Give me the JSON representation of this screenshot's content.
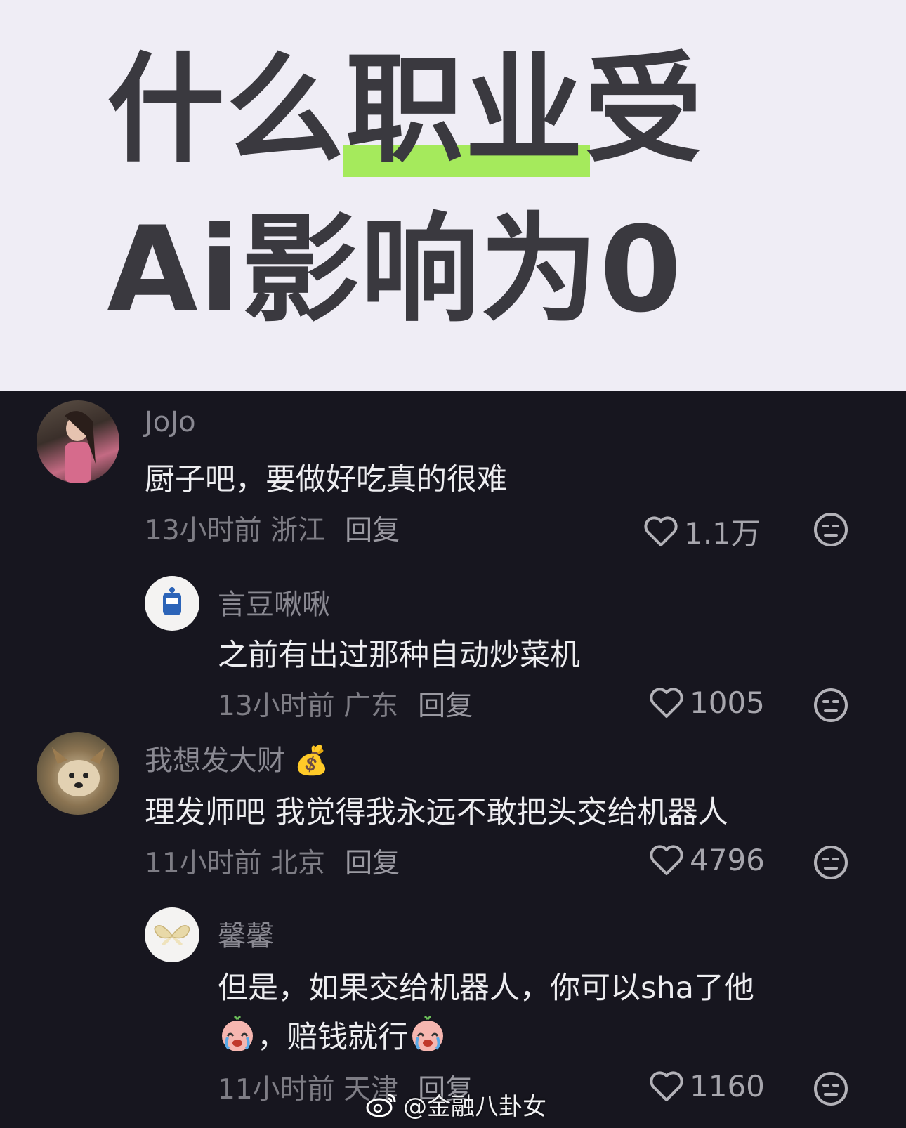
{
  "banner": {
    "title_line1_pre": "什么",
    "title_line1_highlight": "职业",
    "title_line1_post": "受",
    "title_line2": "Ai影响为0",
    "highlight_color": "#a5ea5c"
  },
  "comments": [
    {
      "user": "JoJo",
      "text": "厨子吧，要做好吃真的很难",
      "time": "13小时前",
      "location": "浙江",
      "reply_label": "回复",
      "likes": "1.1万"
    },
    {
      "user": "言豆啾啾",
      "text": "之前有出过那种自动炒菜机",
      "time": "13小时前",
      "location": "广东",
      "reply_label": "回复",
      "likes": "1005"
    },
    {
      "user": "我想发大财",
      "user_emoji": "💰",
      "text": "理发师吧 我觉得我永远不敢把头交给机器人",
      "time": "11小时前",
      "location": "北京",
      "reply_label": "回复",
      "likes": "4796"
    },
    {
      "user": "馨馨",
      "text_line1": "但是，如果交给机器人，你可以sha了他",
      "text_line2_a": "，赔钱就行",
      "time": "11小时前",
      "location": "天津",
      "reply_label": "回复",
      "likes": "1160"
    }
  ],
  "watermark": "@金融八卦女",
  "icons": [
    "heart-icon",
    "neutral-face-icon",
    "money-bag-icon",
    "crying-emoji-icon",
    "weibo-logo"
  ]
}
